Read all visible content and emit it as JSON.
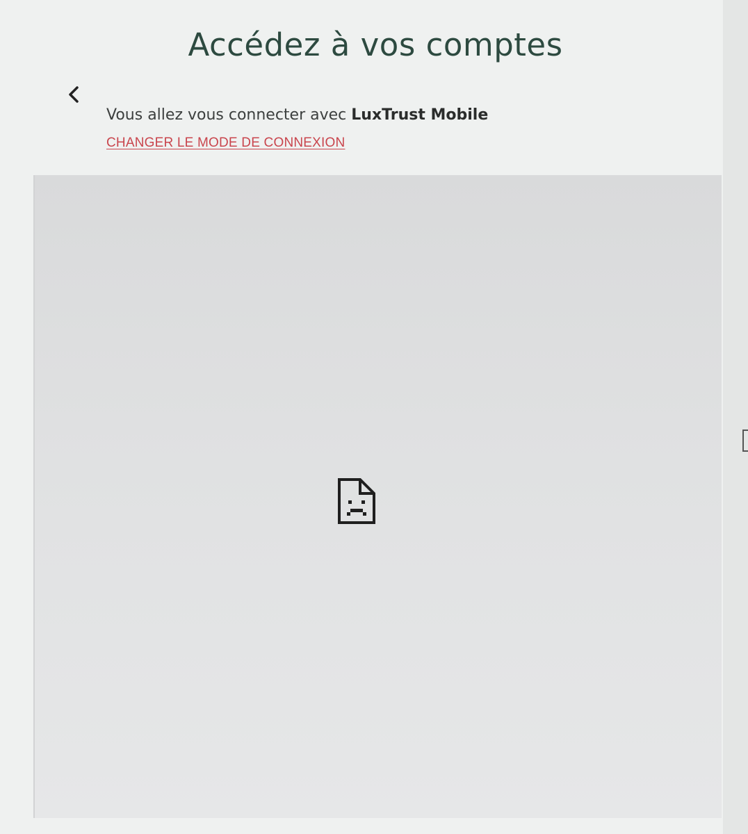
{
  "header": {
    "title": "Accédez à vos comptes"
  },
  "login": {
    "prefix": "Vous allez vous connecter avec ",
    "method": "LuxTrust Mobile",
    "change_link": "CHANGER LE MODE DE CONNEXION"
  },
  "icons": {
    "back": "chevron-left-icon",
    "frame_error": "sad-file-icon"
  },
  "colors": {
    "title": "#2d4a40",
    "link": "#c9454d",
    "panel": "#e0e1e2"
  }
}
